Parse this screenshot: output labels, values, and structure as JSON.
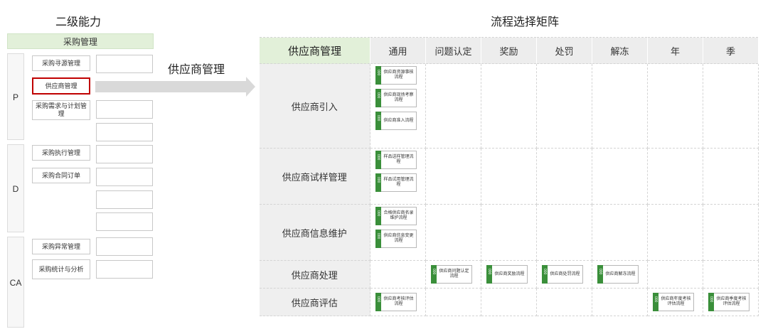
{
  "left": {
    "title": "二级能力",
    "top_box": "采购管理",
    "groups": [
      "P",
      "D",
      "CA"
    ],
    "p_items": [
      "采购寻源管理",
      "供应商管理",
      "采购需求与计划管理"
    ],
    "d_items": [
      "采购执行管理",
      "采购合同订单"
    ],
    "ca_items": [
      "采购异常管理",
      "采购统计与分析"
    ]
  },
  "arrow_label": "供应商管理",
  "matrix": {
    "title": "流程选择矩阵",
    "corner": "供应商管理",
    "columns": [
      "通用",
      "问题认定",
      "奖励",
      "处罚",
      "解冻",
      "年",
      "季"
    ],
    "rows": [
      {
        "label": "供应商引入",
        "cells": [
          [
            "供应商资源事核流程",
            "供应商现场考察流程",
            "供应商准入流程"
          ],
          [],
          [],
          [],
          [],
          [],
          []
        ]
      },
      {
        "label": "供应商试样管理",
        "cells": [
          [
            "样品送样管理流程",
            "样品试用管理流程"
          ],
          [],
          [],
          [],
          [],
          [],
          []
        ]
      },
      {
        "label": "供应商信息维护",
        "cells": [
          [
            "合格供应商名录维护流程",
            "供应商信息变更流程"
          ],
          [],
          [],
          [],
          [],
          [],
          []
        ]
      },
      {
        "label": "供应商处理",
        "cells": [
          [],
          [
            "供应商问题认定流程"
          ],
          [
            "供应商奖励流程"
          ],
          [
            "供应商处罚流程"
          ],
          [
            "供应商解冻流程"
          ],
          [],
          []
        ]
      },
      {
        "label": "供应商评估",
        "cells": [
          [
            "供应商考核评估流程"
          ],
          [],
          [],
          [],
          [],
          [
            "供应商年度考核评估流程"
          ],
          [
            "供应商季度考核评估流程"
          ]
        ]
      }
    ],
    "tag": "000"
  },
  "colors": {
    "corner_bg": "#e2f0d9",
    "tag_green": "#3a8f3a",
    "highlight": "#c00000"
  }
}
